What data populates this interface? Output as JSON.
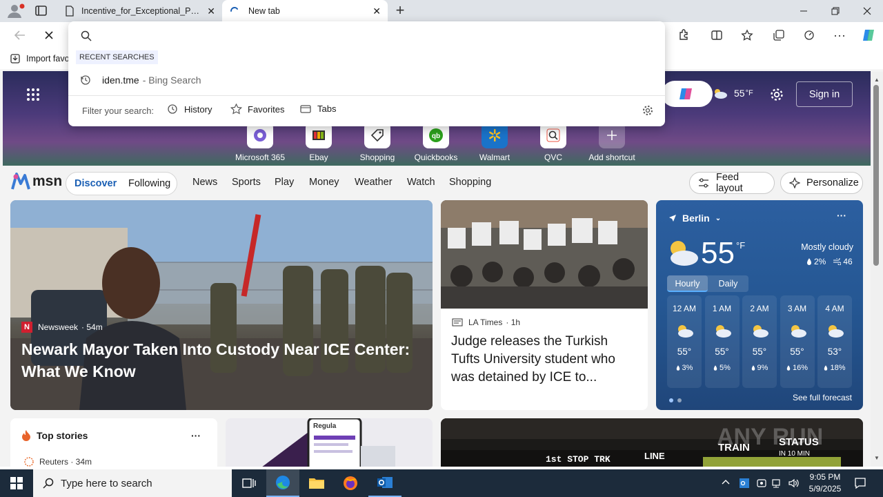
{
  "browser": {
    "tabs": [
      {
        "title": "Incentive_for_Exceptional_Perfor",
        "active": false
      },
      {
        "title": "New tab",
        "active": true
      }
    ],
    "favorites_bar": {
      "import_label": "Import favo"
    }
  },
  "omnibox": {
    "value": "",
    "recent_header": "RECENT SEARCHES",
    "recent_items": [
      {
        "term": "iden.tme",
        "source": "- Bing Search"
      }
    ],
    "filter_label": "Filter your search:",
    "filters": [
      "History",
      "Favorites",
      "Tabs"
    ]
  },
  "msn": {
    "header": {
      "temperature": "55",
      "unit": "°F",
      "sign_in": "Sign in"
    },
    "shortcuts": [
      "Microsoft 365",
      "Ebay",
      "Shopping",
      "Quickbooks",
      "Walmart",
      "QVC",
      "Add shortcut"
    ],
    "logo": "msn",
    "tabs": {
      "discover": "Discover",
      "following": "Following"
    },
    "nav": [
      "News",
      "Sports",
      "Play",
      "Money",
      "Weather",
      "Watch",
      "Shopping"
    ],
    "feed_layout": "Feed layout",
    "personalize": "Personalize"
  },
  "hero_story": {
    "source": "Newsweek",
    "age": "· 54m",
    "headline": "Newark Mayor Taken Into Custody Near ICE Center: What We Know"
  },
  "second_story": {
    "source": "LA Times",
    "age": "· 1h",
    "headline": "Judge releases the Turkish Tufts University student who was detained by ICE to..."
  },
  "weather": {
    "city": "Berlin",
    "temp": "55",
    "unit": "°F",
    "condition": "Mostly cloudy",
    "precip": "2%",
    "aqi": "46",
    "tab_hourly": "Hourly",
    "tab_daily": "Daily",
    "hours": [
      {
        "time": "12 AM",
        "temp": "55°",
        "precip": "3%"
      },
      {
        "time": "1 AM",
        "temp": "55°",
        "precip": "5%"
      },
      {
        "time": "2 AM",
        "temp": "55°",
        "precip": "9%"
      },
      {
        "time": "3 AM",
        "temp": "55°",
        "precip": "16%"
      },
      {
        "time": "4 AM",
        "temp": "53°",
        "precip": "18%"
      }
    ],
    "see_full": "See full forecast"
  },
  "top_stories": {
    "title": "Top stories",
    "first_source": "Reuters · 34m"
  },
  "ad_brand": "Regula",
  "train_board": {
    "stop": "1st STOP TRK",
    "line": "LINE",
    "train": "TRAIN",
    "status": "STATUS",
    "in_min": "IN 10 MIN"
  },
  "watermark": "ANY RUN",
  "taskbar": {
    "search_placeholder": "Type here to search",
    "time": "9:05 PM",
    "date": "5/9/2025"
  }
}
